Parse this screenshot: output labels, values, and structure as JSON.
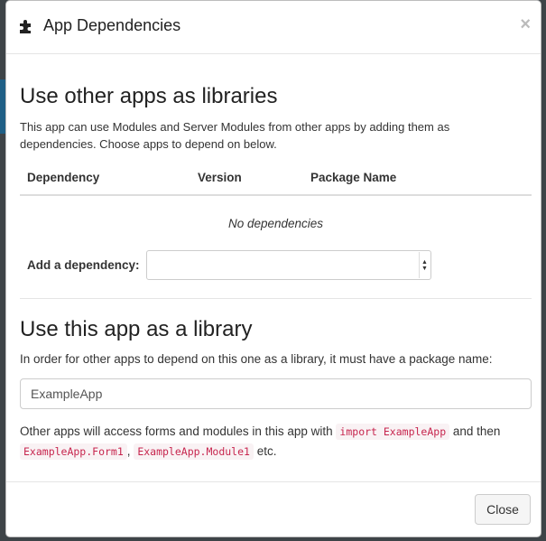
{
  "modal": {
    "title": "App Dependencies",
    "close_glyph": "×",
    "icon": "puzzle-icon"
  },
  "libraries": {
    "heading": "Use other apps as libraries",
    "intro": "This app can use Modules and Server Modules from other apps by adding them as dependencies. Choose apps to depend on below.",
    "columns": [
      "Dependency",
      "Version",
      "Package Name"
    ],
    "empty_text": "No dependencies",
    "add_label": "Add a dependency:",
    "select_value": ""
  },
  "library": {
    "heading": "Use this app as a library",
    "note": "In order for other apps to depend on this one as a library, it must have a package name:",
    "package_name": "ExampleApp",
    "access_prefix": "Other apps will access forms and modules in this app with",
    "import_code": "import ExampleApp",
    "access_middle": "and then",
    "form_code": "ExampleApp.Form1",
    "comma": ",",
    "module_code": "ExampleApp.Module1",
    "access_suffix": "etc."
  },
  "footer": {
    "close_label": "Close"
  },
  "colors": {
    "code_text": "#c7254e",
    "code_bg": "#f9f2f4",
    "backdrop": "#3e4448"
  }
}
